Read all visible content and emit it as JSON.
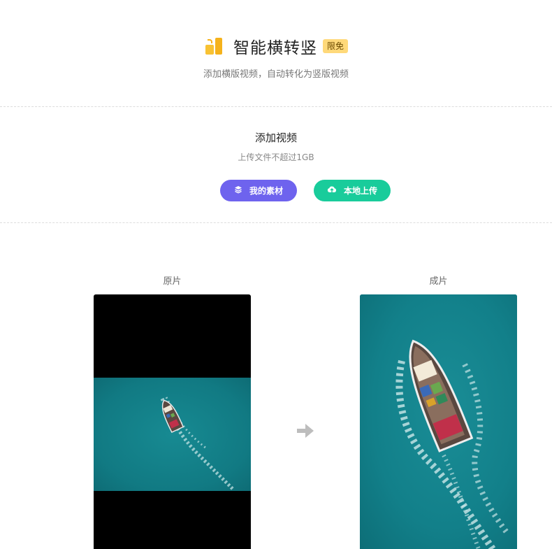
{
  "header": {
    "title": "智能横转竖",
    "badge": "限免",
    "subtitle": "添加横版视频，自动转化为竖版视频"
  },
  "upload": {
    "title": "添加视频",
    "hint": "上传文件不超过1GB",
    "buttons": {
      "material_label": "我的素材",
      "local_upload_label": "本地上传"
    }
  },
  "preview": {
    "original_label": "原片",
    "result_label": "成片"
  },
  "colors": {
    "accent_purple": "#6e63ee",
    "accent_green": "#19cc9b",
    "badge_bg": "#ffd97a",
    "icon_yellow": "#f5b21b",
    "sea": "#12818a"
  }
}
